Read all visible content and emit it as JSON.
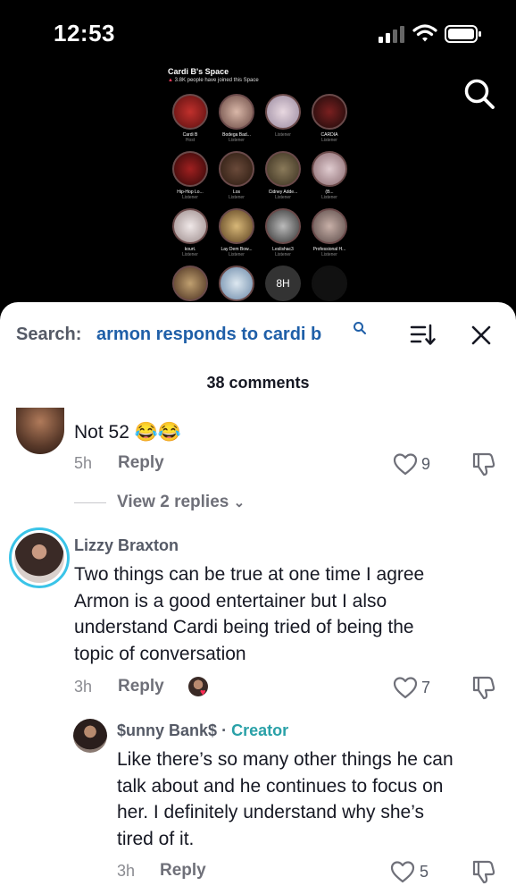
{
  "status": {
    "time": "12:53"
  },
  "video": {
    "space_title": "Cardi B's Space",
    "space_sub": "3.8K people have joined this Space",
    "participants": [
      {
        "name": "Cardi B",
        "role": "Host"
      },
      {
        "name": "Bodega Bad...",
        "role": "Listener"
      },
      {
        "name": "",
        "role": "Listener"
      },
      {
        "name": "CARDIA",
        "role": "Listener"
      },
      {
        "name": "Hip-Hop Lo...",
        "role": "Listener"
      },
      {
        "name": "Los",
        "role": "Listener"
      },
      {
        "name": "Cidney Adde...",
        "role": "Listener"
      },
      {
        "name": "(B...",
        "role": "Listener"
      },
      {
        "name": "kourt.",
        "role": "Listener"
      },
      {
        "name": "Lay Dem Bow...",
        "role": "Listener"
      },
      {
        "name": "Leslishac3",
        "role": "Listener"
      },
      {
        "name": "Professional H...",
        "role": "Listener"
      },
      {
        "name": "",
        "role": ""
      },
      {
        "name": "",
        "role": ""
      },
      {
        "name": "8H",
        "role": ""
      },
      {
        "name": "",
        "role": ""
      }
    ]
  },
  "sheet": {
    "search_label": "Search:",
    "search_query": "armon responds to cardi b",
    "comment_count": "38 comments"
  },
  "comments": [
    {
      "text": "Not 52 😂😂",
      "time": "5h",
      "reply_label": "Reply",
      "likes": "9",
      "view_replies": "View 2 replies"
    },
    {
      "author": "Lizzy Braxton",
      "text_lines": [
        "Two things can be true at one time I agree",
        "Armon is a good entertainer but I also",
        "understand Cardi being tried of being the",
        "topic of conversation"
      ],
      "time": "3h",
      "reply_label": "Reply",
      "likes": "7"
    },
    {
      "author": "$unny Bank$",
      "separator": "·",
      "badge": "Creator",
      "text_lines": [
        "Like there’s so many other things he can",
        "talk about and he continues to focus on",
        "her. I definitely understand why she’s",
        "tired of it."
      ],
      "time": "3h",
      "reply_label": "Reply",
      "likes": "5"
    }
  ]
}
